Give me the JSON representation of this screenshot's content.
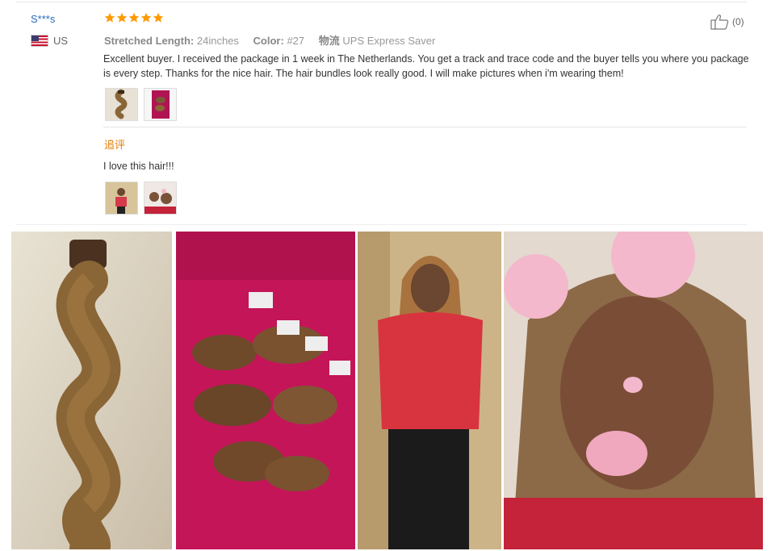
{
  "reviewer": {
    "name": "S***s",
    "country": "US",
    "flag": "us-flag-icon"
  },
  "rating": {
    "stars": 5,
    "max": 5,
    "color": "#ff9a00"
  },
  "meta": {
    "length_key": "Stretched Length:",
    "length_value": "24inches",
    "color_key": "Color:",
    "color_value": "#27",
    "shipping_key": "物流",
    "shipping_value": "UPS Express Saver"
  },
  "helpful": {
    "icon": "thumbs-up-icon",
    "count": "(0)"
  },
  "review": {
    "text": "Excellent buyer. I received the package in 1 week in The Netherlands. You get a track and trace code and the buyer tells you where you package is every step. Thanks for the nice hair. The hair bundles look really good. I will make pictures when i'm wearing them!"
  },
  "followup": {
    "label": "追评",
    "text": "I love this hair!!!"
  },
  "photos": [
    "hair-bundle-photo",
    "packaged-bundles-photo",
    "wearing-hair-photo",
    "selfie-photo"
  ],
  "colors": {
    "name_link": "#2a6bb8",
    "followup_label": "#e87b00",
    "magenta_bg": "#c41558",
    "hair": "#8a6536"
  }
}
